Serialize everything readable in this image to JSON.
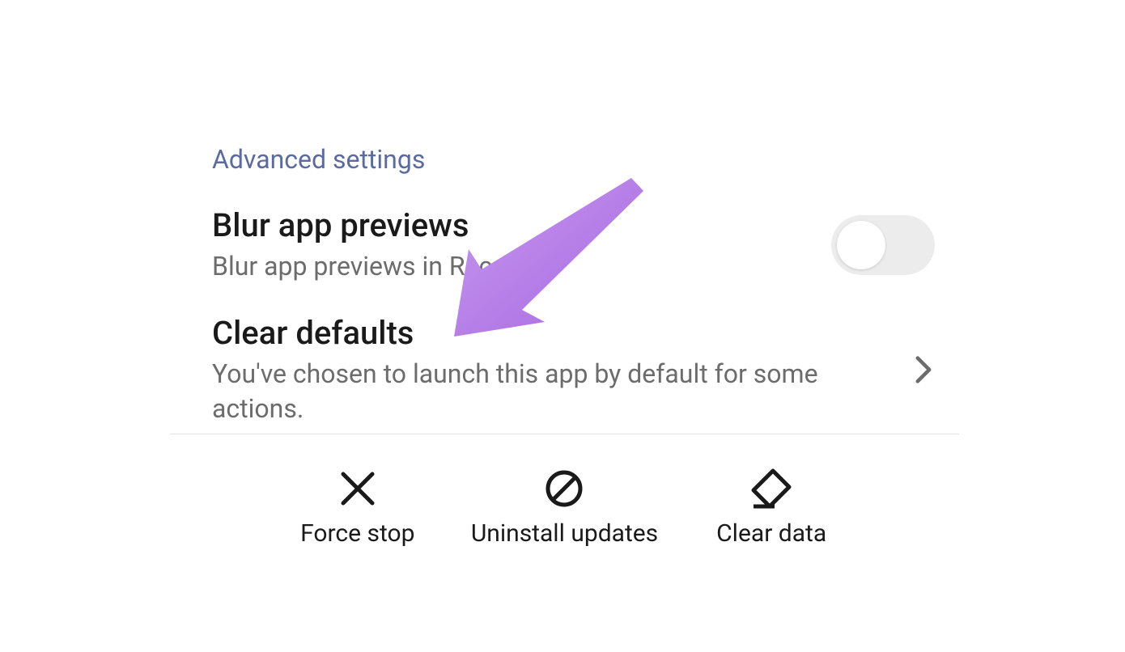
{
  "section": {
    "title": "Advanced settings"
  },
  "rows": {
    "blur": {
      "title": "Blur app previews",
      "sub": "Blur app previews in Recents",
      "toggle_on": false
    },
    "clear_defaults": {
      "title": "Clear defaults",
      "sub": "You've chosen to launch this app by default for some actions."
    }
  },
  "actions": {
    "force_stop": "Force stop",
    "uninstall_updates": "Uninstall updates",
    "clear_data": "Clear data"
  },
  "colors": {
    "section_title": "#5b6aa1",
    "arrow": "#b47de8"
  }
}
